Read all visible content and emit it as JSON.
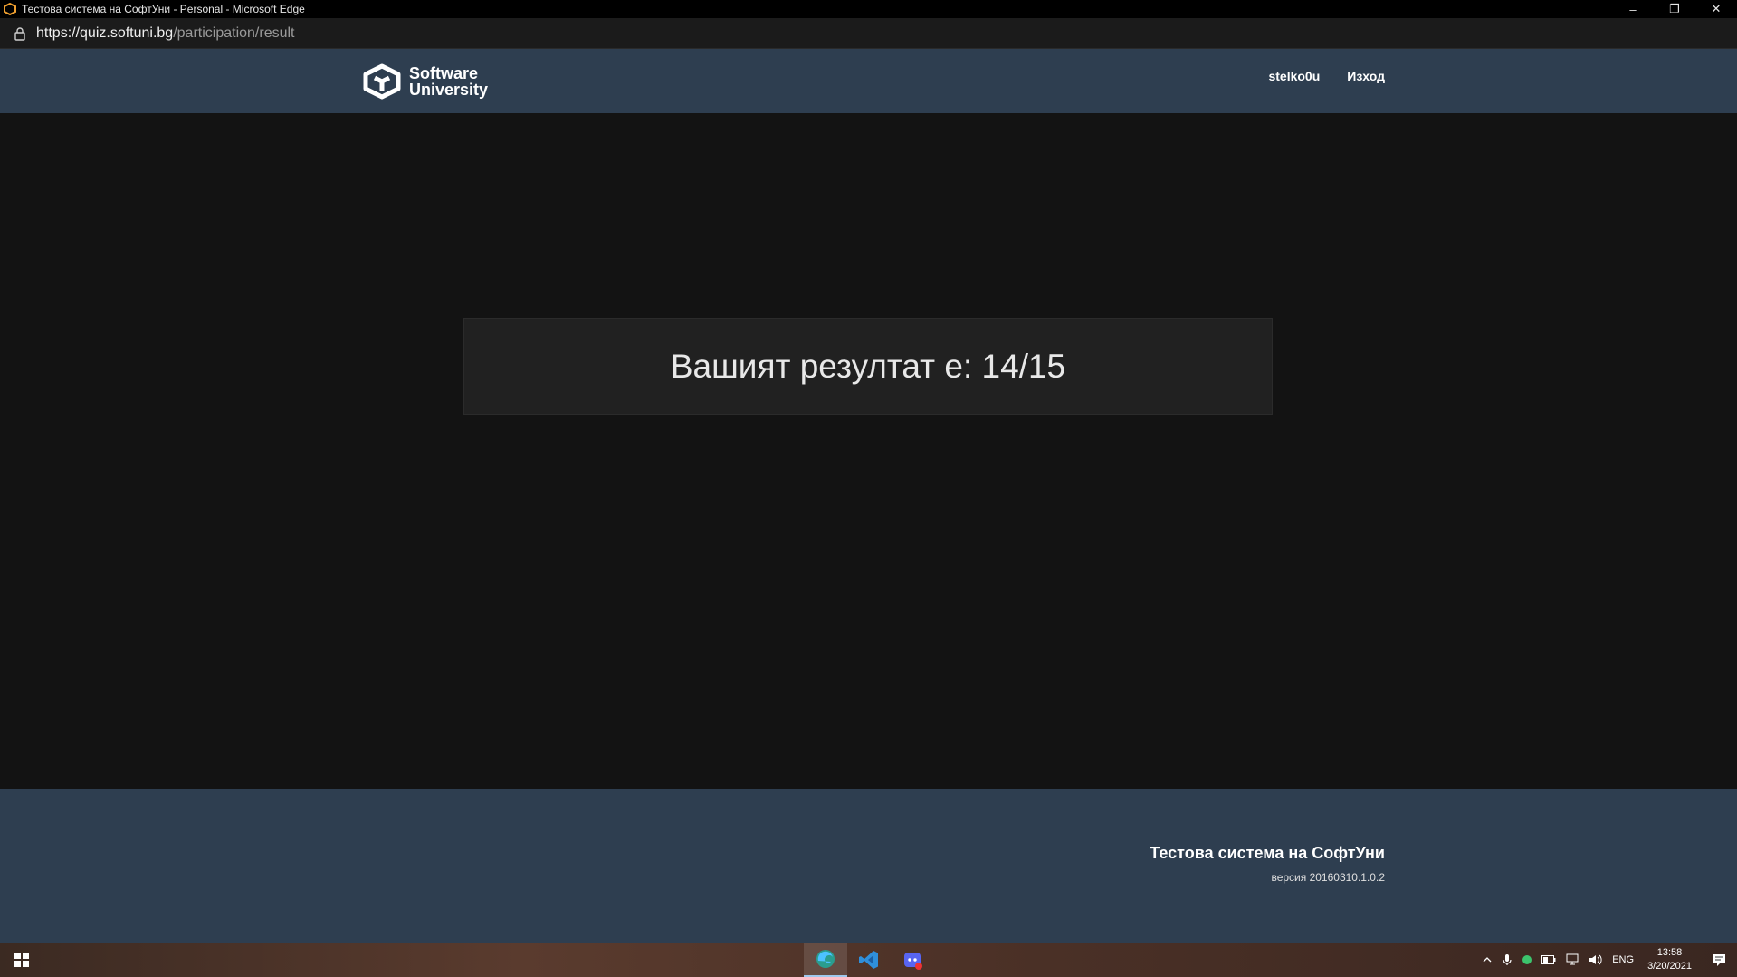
{
  "window": {
    "title": "Тестова система на СофтУни - Personal - Microsoft Edge",
    "controls": {
      "minimize": "–",
      "restore": "❐",
      "close": "✕"
    }
  },
  "address_bar": {
    "url_host": "https://quiz.softuni.bg",
    "url_path": "/participation/result"
  },
  "header": {
    "logo_line1": "Software",
    "logo_line2": "University",
    "username": "stelko0u",
    "logout_label": "Изход"
  },
  "result": {
    "text": "Вашият резултат е: 14/15"
  },
  "footer": {
    "title": "Тестова система на СофтУни",
    "version": "версия 20160310.1.0.2"
  },
  "taskbar": {
    "apps": [
      "edge-icon",
      "vscode-icon",
      "discord-icon"
    ],
    "tray": {
      "language": "ENG",
      "time": "13:58",
      "date": "3/20/2021"
    }
  },
  "colors": {
    "header_bg": "#2e3e50",
    "page_bg": "#131313",
    "result_box_bg": "#212121"
  }
}
